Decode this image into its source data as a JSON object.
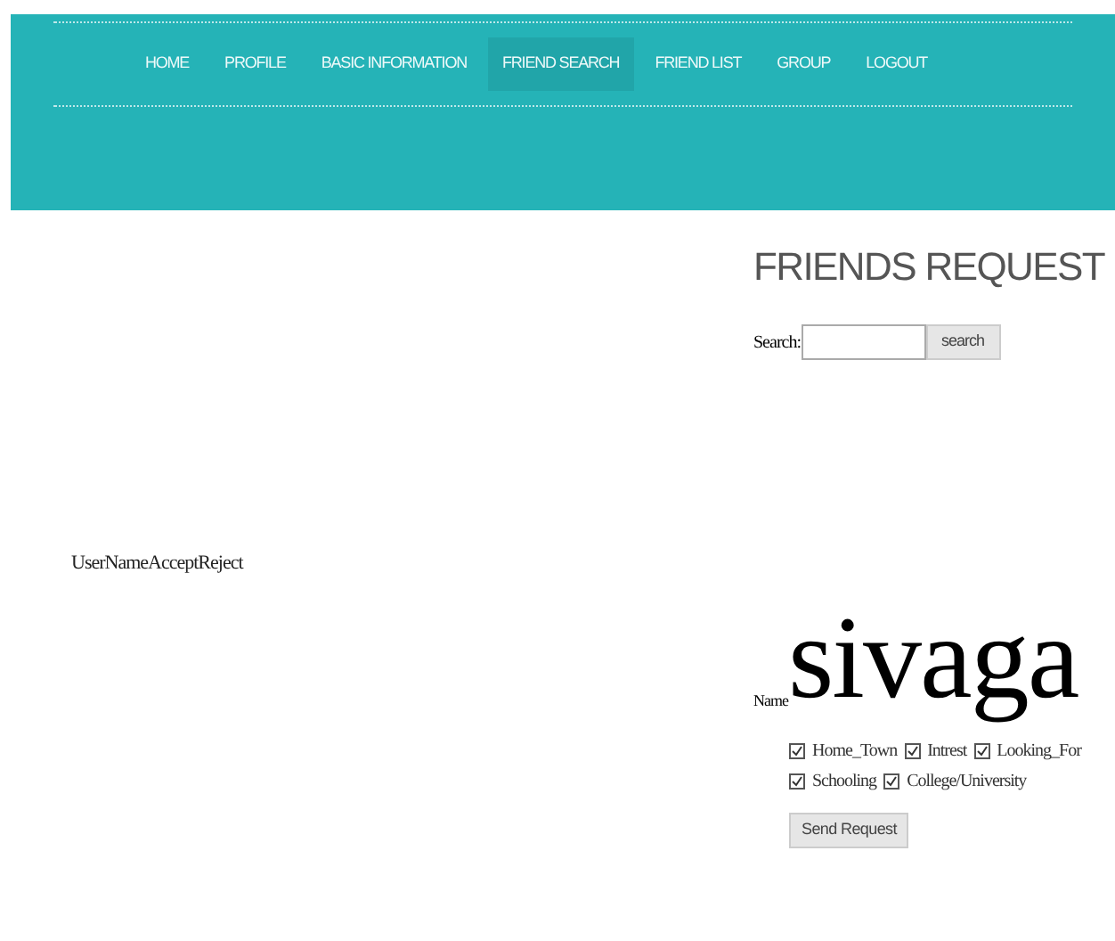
{
  "nav": {
    "items": [
      {
        "label": "HOME",
        "selected": false
      },
      {
        "label": "PROFILE",
        "selected": false
      },
      {
        "label": "BASIC INFORMATION",
        "selected": false
      },
      {
        "label": "FRIEND SEARCH",
        "selected": true
      },
      {
        "label": "FRIEND LIST",
        "selected": false
      },
      {
        "label": "GROUP",
        "selected": false
      },
      {
        "label": "LOGOUT",
        "selected": false
      }
    ]
  },
  "requests": {
    "header": "UserNameAcceptReject"
  },
  "panel": {
    "title": "FRIENDS REQUEST",
    "search_label": "Search:",
    "search_button": "search",
    "name_label": "Name",
    "name_value": "sivaga",
    "options": [
      {
        "label": "Home_Town",
        "checked": true
      },
      {
        "label": "Intrest",
        "checked": true
      },
      {
        "label": "Looking_For",
        "checked": true
      },
      {
        "label": "Schooling",
        "checked": true
      },
      {
        "label": "College/University",
        "checked": true
      }
    ],
    "send_button": "Send Request"
  }
}
